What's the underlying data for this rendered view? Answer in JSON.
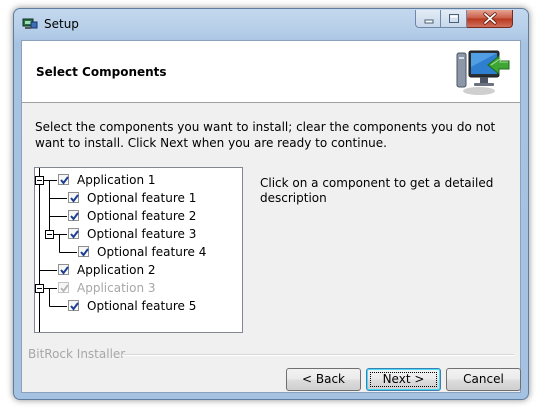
{
  "window": {
    "title": "Setup"
  },
  "header": {
    "title": "Select Components"
  },
  "intro_text": "Select the components you want to install; clear the components you do not want to install. Click Next when you are ready to continue.",
  "tree": {
    "nodes": [
      {
        "label": "Application 1",
        "checked": true,
        "disabled": false
      },
      {
        "label": "Optional feature 1",
        "checked": true,
        "disabled": false
      },
      {
        "label": "Optional feature 2",
        "checked": true,
        "disabled": false
      },
      {
        "label": "Optional feature 3",
        "checked": true,
        "disabled": false
      },
      {
        "label": "Optional feature 4",
        "checked": true,
        "disabled": false
      },
      {
        "label": "Application 2",
        "checked": true,
        "disabled": false
      },
      {
        "label": "Application 3",
        "checked": true,
        "disabled": true
      },
      {
        "label": "Optional feature 5",
        "checked": true,
        "disabled": false
      }
    ]
  },
  "description": "Click on a component to get a detailed description",
  "brand": "BitRock Installer",
  "buttons": {
    "back": "< Back",
    "next": "Next >",
    "cancel": "Cancel"
  },
  "colors": {
    "title_bar": "#b7cfe9",
    "close_button": "#c75a44",
    "check": "#1c3f94",
    "disabled_text": "#a7a7a7"
  },
  "icons": [
    "setup-app-icon",
    "minimize-icon",
    "maximize-icon",
    "close-icon",
    "computer-install-icon",
    "checkmark-icon",
    "tree-expander-icon"
  ]
}
